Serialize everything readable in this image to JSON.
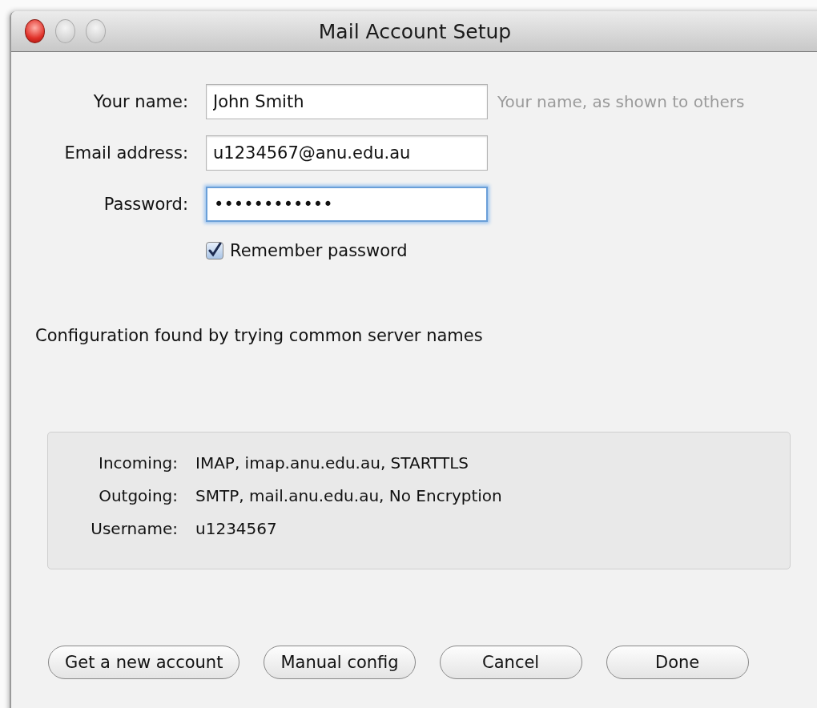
{
  "window": {
    "title": "Mail Account Setup"
  },
  "fields": [
    {
      "label": "Your name:",
      "value": "John Smith",
      "hint": "Your name, as shown to others",
      "focused": false
    },
    {
      "label": "Email address:",
      "value": "u1234567@anu.edu.au",
      "focused": false
    },
    {
      "label": "Password:",
      "value": "••••••••••••",
      "focused": true
    }
  ],
  "remember_password": {
    "label": "Remember password",
    "checked": true
  },
  "status": "Configuration found by trying common server names",
  "config": [
    {
      "label": "Incoming:",
      "value": "IMAP, imap.anu.edu.au, STARTTLS"
    },
    {
      "label": "Outgoing:",
      "value": "SMTP, mail.anu.edu.au, No Encryption"
    },
    {
      "label": "Username:",
      "value": "u1234567"
    }
  ],
  "buttons": [
    "Get a new account",
    "Manual config",
    "Cancel",
    "Done"
  ]
}
